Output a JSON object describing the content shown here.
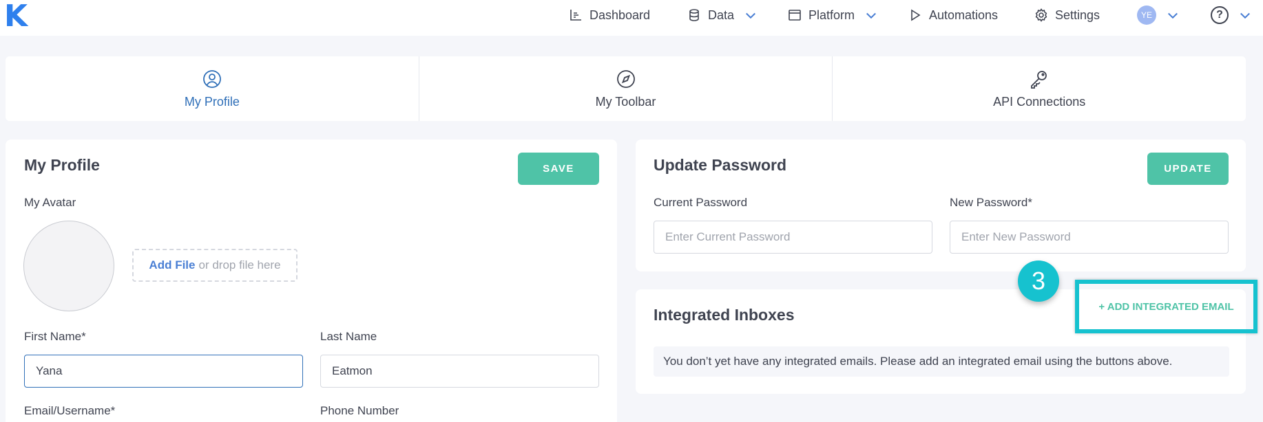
{
  "app": {
    "logo": "K"
  },
  "nav": {
    "items": [
      {
        "label": "Dashboard"
      },
      {
        "label": "Data"
      },
      {
        "label": "Platform"
      },
      {
        "label": "Automations"
      },
      {
        "label": "Settings"
      }
    ],
    "user_initials": "YE",
    "help": "?"
  },
  "tabs": [
    {
      "label": "My Profile",
      "icon": "user-circle-icon",
      "active": true
    },
    {
      "label": "My Toolbar",
      "icon": "compass-icon",
      "active": false
    },
    {
      "label": "API Connections",
      "icon": "key-icon",
      "active": false
    }
  ],
  "profile": {
    "title": "My Profile",
    "save_label": "SAVE",
    "avatar_label": "My Avatar",
    "dropzone": {
      "add": "Add File",
      "rest": "or drop file here"
    },
    "first_name": {
      "label": "First Name*",
      "value": "Yana"
    },
    "last_name": {
      "label": "Last Name",
      "value": "Eatmon"
    },
    "email": {
      "label": "Email/Username*"
    },
    "phone": {
      "label": "Phone Number"
    }
  },
  "password": {
    "title": "Update Password",
    "update_label": "UPDATE",
    "current": {
      "label": "Current Password",
      "placeholder": "Enter Current Password"
    },
    "new": {
      "label": "New Password*",
      "placeholder": "Enter New Password"
    }
  },
  "inboxes": {
    "title": "Integrated Inboxes",
    "add_label": "+ ADD INTEGRATED EMAIL",
    "empty_message": "You don’t yet have any integrated emails. Please add an integrated email using the buttons above."
  },
  "annotation": {
    "step": "3",
    "highlight_color": "#16c2cf"
  },
  "colors": {
    "accent": "#4fc3a7",
    "link": "#2f6fb8",
    "logo": "#2f80ed"
  }
}
